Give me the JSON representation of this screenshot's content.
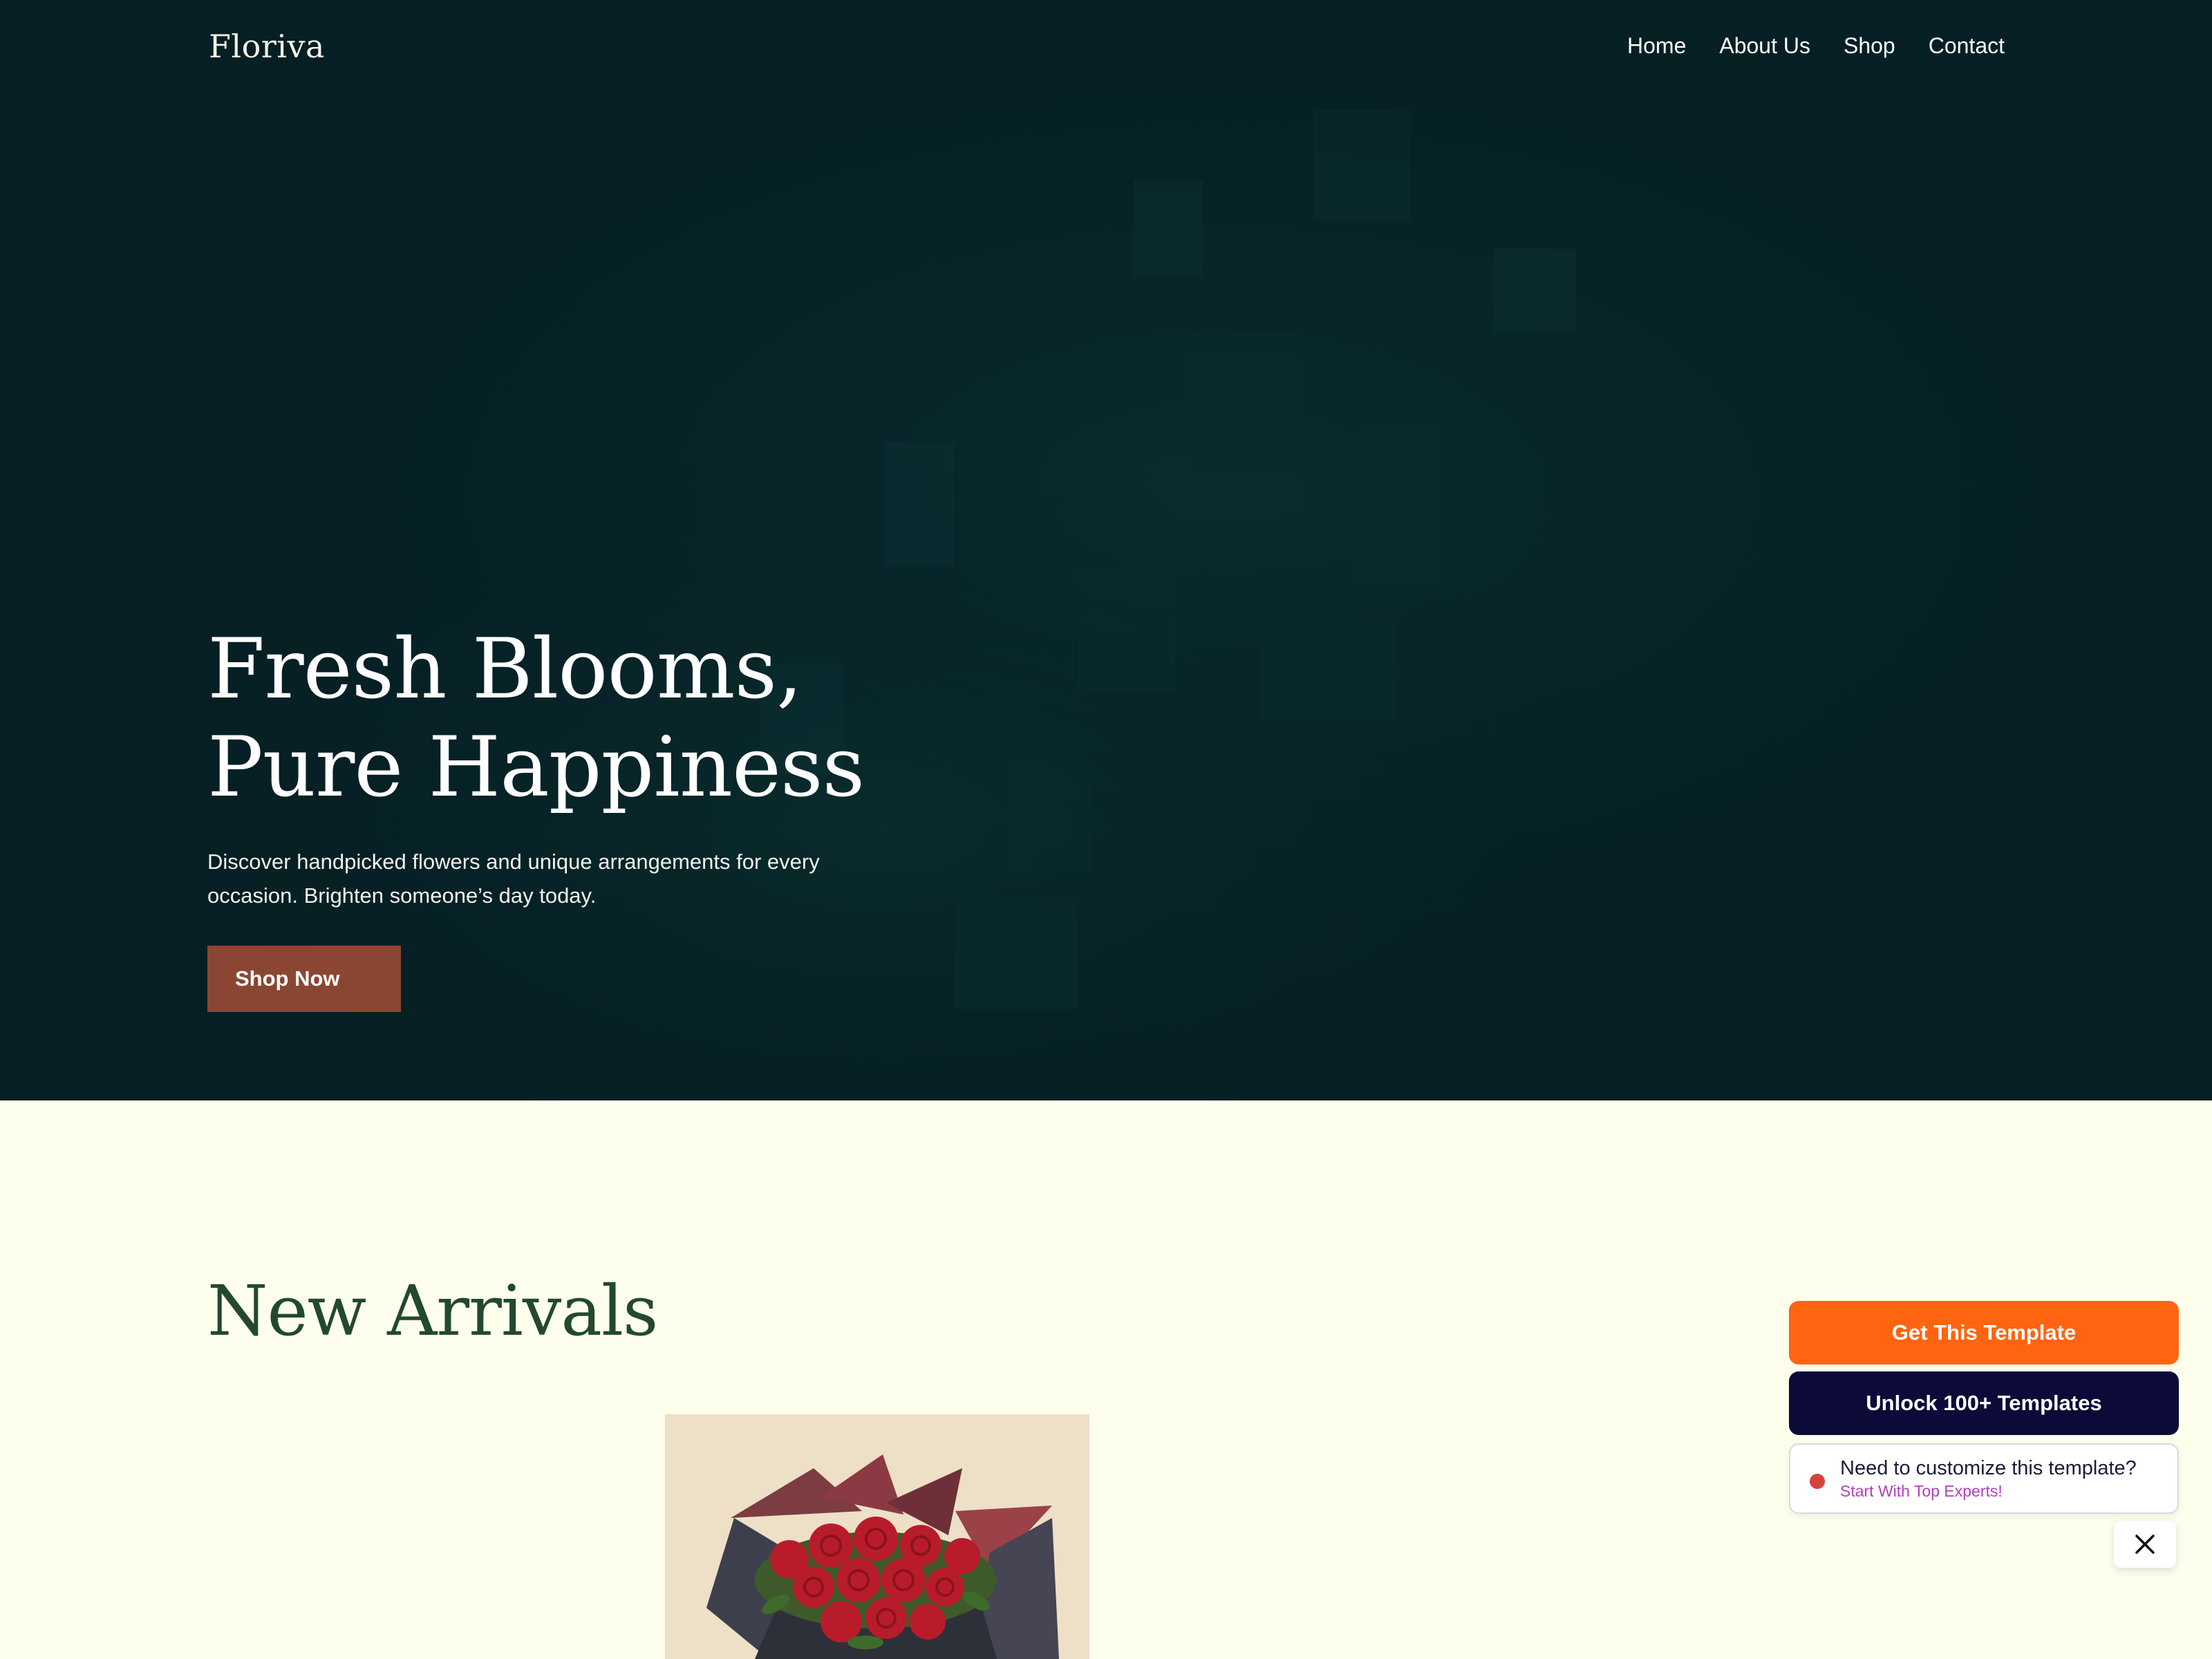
{
  "brand": {
    "name": "Floriva"
  },
  "nav": {
    "items": [
      {
        "label": "Home"
      },
      {
        "label": "About Us"
      },
      {
        "label": "Shop"
      },
      {
        "label": "Contact"
      }
    ]
  },
  "hero": {
    "title_line1": "Fresh Blooms,",
    "title_line2": "Pure Happiness",
    "subtitle": "Discover handpicked flowers and unique arrangements for every occasion. Brighten someone’s day today.",
    "cta_label": "Shop Now"
  },
  "new_arrivals": {
    "title": "New Arrivals"
  },
  "promo_widget": {
    "get_template_label": "Get This Template",
    "unlock_label": "Unlock 100+ Templates",
    "customize_question": "Need to customize this template?",
    "experts_link": "Start With Top Experts!",
    "close_icon": "close-icon"
  },
  "colors": {
    "hero_bg": "#061F24",
    "page_bg": "#FEFEEC",
    "cta_bg": "#8A4632",
    "heading_green": "#22492E",
    "widget_orange": "#FF6410",
    "widget_navy": "#0C0A38",
    "status_dot": "#D8403E",
    "link_purple": "#B23EBE"
  }
}
